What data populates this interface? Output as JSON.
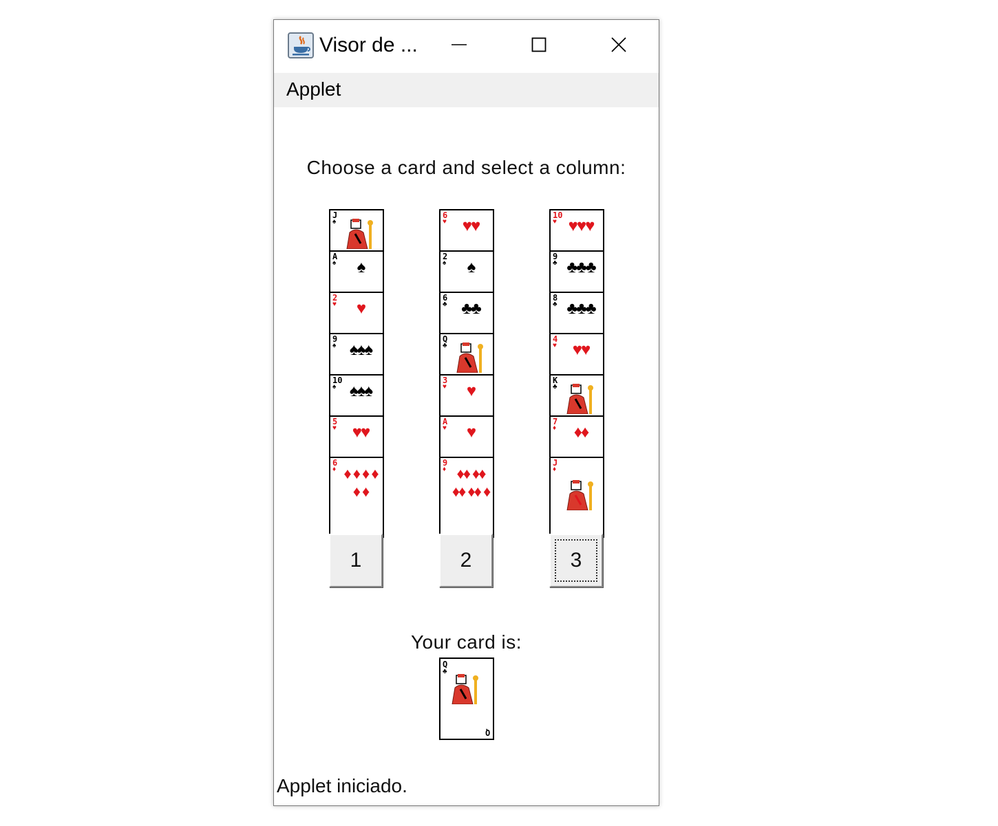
{
  "window": {
    "title": "Visor de ...",
    "icon": "java-icon",
    "controls": [
      "minimize-icon",
      "maximize-icon",
      "close-icon"
    ]
  },
  "menu": {
    "items": [
      {
        "label": "Applet"
      }
    ]
  },
  "prompt": "Choose a card and select a column:",
  "columns": [
    {
      "button_label": "1",
      "cards": [
        {
          "rank": "J",
          "suit": "♠",
          "color": "black",
          "kind": "face"
        },
        {
          "rank": "A",
          "suit": "♠",
          "color": "black",
          "pips": "♠"
        },
        {
          "rank": "2",
          "suit": "♥",
          "color": "red",
          "pips": "♥"
        },
        {
          "rank": "9",
          "suit": "♠",
          "color": "black",
          "pips": "♠♠♠"
        },
        {
          "rank": "10",
          "suit": "♠",
          "color": "black",
          "pips": "♠♠♠"
        },
        {
          "rank": "5",
          "suit": "♥",
          "color": "red",
          "pips": "♥♥"
        },
        {
          "rank": "6",
          "suit": "♦",
          "color": "red",
          "pips": "♦ ♦ ♦ ♦ ♦ ♦"
        }
      ]
    },
    {
      "button_label": "2",
      "cards": [
        {
          "rank": "6",
          "suit": "♥",
          "color": "red",
          "pips": "♥♥"
        },
        {
          "rank": "2",
          "suit": "♠",
          "color": "black",
          "pips": "♠"
        },
        {
          "rank": "6",
          "suit": "♣",
          "color": "black",
          "pips": "♣♣"
        },
        {
          "rank": "Q",
          "suit": "♣",
          "color": "black",
          "kind": "face"
        },
        {
          "rank": "3",
          "suit": "♥",
          "color": "red",
          "pips": "♥"
        },
        {
          "rank": "A",
          "suit": "♥",
          "color": "red",
          "pips": "♥"
        },
        {
          "rank": "9",
          "suit": "♦",
          "color": "red",
          "pips": "♦♦ ♦♦ ♦♦ ♦♦ ♦"
        }
      ]
    },
    {
      "button_label": "3",
      "cards": [
        {
          "rank": "10",
          "suit": "♥",
          "color": "red",
          "pips": "♥♥♥"
        },
        {
          "rank": "9",
          "suit": "♣",
          "color": "black",
          "pips": "♣♣♣"
        },
        {
          "rank": "8",
          "suit": "♣",
          "color": "black",
          "pips": "♣♣♣"
        },
        {
          "rank": "4",
          "suit": "♥",
          "color": "red",
          "pips": "♥♥"
        },
        {
          "rank": "K",
          "suit": "♣",
          "color": "black",
          "kind": "face"
        },
        {
          "rank": "7",
          "suit": "♦",
          "color": "red",
          "pips": "♦♦"
        },
        {
          "rank": "J",
          "suit": "♦",
          "color": "red",
          "kind": "face"
        }
      ]
    }
  ],
  "result": {
    "label": "Your card is:",
    "card": {
      "rank": "Q",
      "suit": "♣",
      "color": "black",
      "kind": "face"
    }
  },
  "status": "Applet iniciado.",
  "colors": {
    "red_suit": "#e0161d",
    "face_red": "#d9382c",
    "face_gold": "#f0b020",
    "menubar_bg": "#f0f0f0"
  }
}
